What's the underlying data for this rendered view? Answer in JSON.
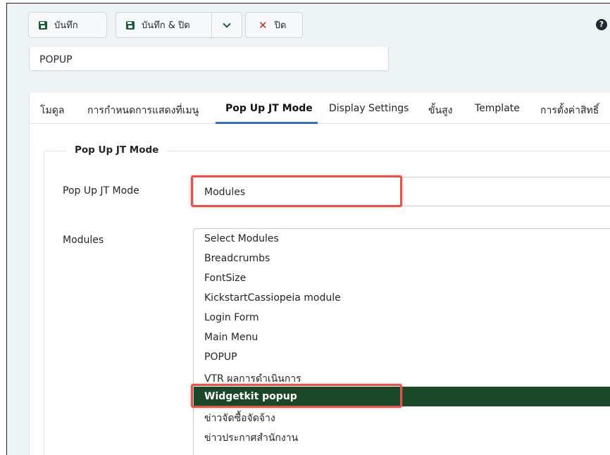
{
  "toolbar": {
    "save_label": "บันทึก",
    "save_close_label": "บันทึก & ปิด",
    "close_label": "ปิด",
    "help_glyph": "?",
    "close_glyph": "✕"
  },
  "module_title": "POPUP",
  "tabs": [
    {
      "label": "โมดูล"
    },
    {
      "label": "การกำหนดการแสดงที่เมนู"
    },
    {
      "label": "Pop Up JT Mode",
      "active": true
    },
    {
      "label": "Display Settings"
    },
    {
      "label": "ขั้นสูง"
    },
    {
      "label": "Template"
    },
    {
      "label": "การตั้งค่าสิทธิ์"
    }
  ],
  "fieldset_legend": "Pop Up JT Mode",
  "fields": {
    "mode_label": "Pop Up JT Mode",
    "mode_value": "Modules",
    "modules_label": "Modules"
  },
  "modules_options": [
    "Select Modules",
    "Breadcrumbs",
    "FontSize",
    "KickstartCassiopeia module",
    "Login Form",
    "Main Menu",
    "POPUP",
    "VTR ผลการดำเนินการ",
    "Widgetkit popup",
    "ข่าวจัดซื้อจัดจ้าง",
    "ข่าวประกาศสำนักงาน"
  ],
  "selected_option": "Widgetkit popup",
  "colors": {
    "selected_bg": "#1b4627",
    "highlight": "#e0564b",
    "active_tab_underline": "#3b6fb5",
    "save_icon": "#1c5c33",
    "close_icon": "#d0261d"
  }
}
